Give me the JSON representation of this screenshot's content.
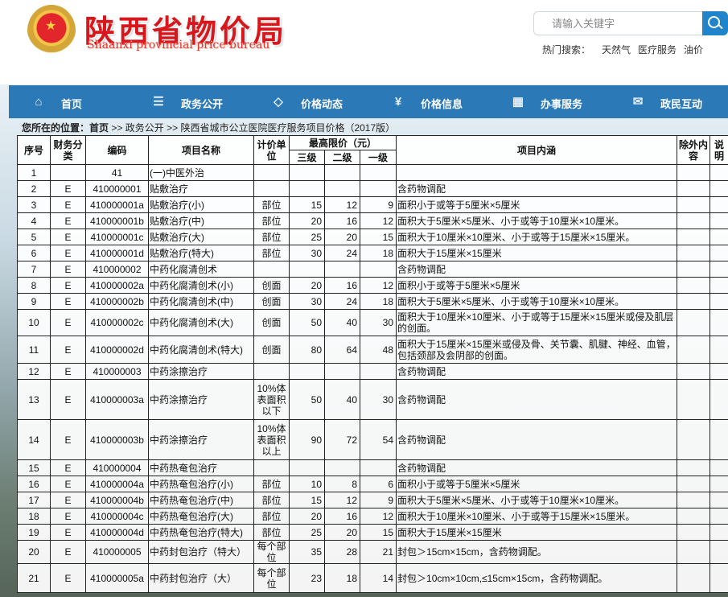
{
  "site": {
    "title_cn": "陕西省物价局",
    "title_en": "Shaanxi provincial price bureau"
  },
  "search": {
    "placeholder": "请输入关键字",
    "hot_label": "热门搜索：",
    "hot": [
      "天然气",
      "医疗服务",
      "油价"
    ]
  },
  "nav": [
    {
      "label": "首页",
      "icon": "home-icon"
    },
    {
      "label": "政务公开",
      "icon": "document-icon"
    },
    {
      "label": "价格动态",
      "icon": "tag-icon"
    },
    {
      "label": "价格信息",
      "icon": "yuan-icon"
    },
    {
      "label": "办事服务",
      "icon": "grid-icon"
    },
    {
      "label": "政民互动",
      "icon": "chat-icon"
    }
  ],
  "breadcrumb": {
    "prefix": "您所在的位置：",
    "items": [
      "首页",
      ">>",
      "政务公开",
      ">>",
      "陕西省城市公立医院医疗服务项目价格（2017版）"
    ]
  },
  "table": {
    "headers": {
      "no": "序号",
      "cat": "财务分类",
      "code": "编码",
      "name": "项目名称",
      "unit": "计价单位",
      "price_group": "最高限价（元）",
      "p3": "三级",
      "p2": "二级",
      "p1": "一级",
      "content": "项目内涵",
      "excl": "除外内容",
      "note": "说明"
    },
    "rows": [
      [
        "1",
        "",
        "41",
        "(一)中医外治",
        "",
        "",
        "",
        "",
        "",
        "",
        ""
      ],
      [
        "2",
        "E",
        "410000001",
        "贴敷治疗",
        "",
        "",
        "",
        "",
        "含药物调配",
        "",
        ""
      ],
      [
        "3",
        "E",
        "410000001a",
        "贴敷治疗(小)",
        "部位",
        "15",
        "12",
        "9",
        "面积小于或等于5厘米×5厘米",
        "",
        ""
      ],
      [
        "4",
        "E",
        "410000001b",
        "贴敷治疗(中)",
        "部位",
        "20",
        "16",
        "12",
        "面积大于5厘米×5厘米、小于或等于10厘米×10厘米。",
        "",
        ""
      ],
      [
        "5",
        "E",
        "410000001c",
        "贴敷治疗(大)",
        "部位",
        "25",
        "20",
        "15",
        "面积大于10厘米×10厘米、小于或等于15厘米×15厘米。",
        "",
        ""
      ],
      [
        "6",
        "E",
        "410000001d",
        "贴敷治疗(特大)",
        "部位",
        "30",
        "24",
        "18",
        "面积大于15厘米×15厘米",
        "",
        ""
      ],
      [
        "7",
        "E",
        "410000002",
        "中药化腐清创术",
        "",
        "",
        "",
        "",
        "含药物调配",
        "",
        ""
      ],
      [
        "8",
        "E",
        "410000002a",
        "中药化腐清创术(小)",
        "创面",
        "20",
        "16",
        "12",
        "面积小于或等于5厘米×5厘米",
        "",
        ""
      ],
      [
        "9",
        "E",
        "410000002b",
        "中药化腐清创术(中)",
        "创面",
        "30",
        "24",
        "18",
        "面积大于5厘米×5厘米、小于或等于10厘米×10厘米。",
        "",
        ""
      ],
      [
        "10",
        "E",
        "410000002c",
        "中药化腐清创术(大)",
        "创面",
        "50",
        "40",
        "30",
        "面积大于10厘米×10厘米、小于或等于15厘米×15厘米或侵及肌层的创面。",
        "",
        ""
      ],
      [
        "11",
        "E",
        "410000002d",
        "中药化腐清创术(特大)",
        "创面",
        "80",
        "64",
        "48",
        "面积大于15厘米×15厘米或侵及骨、关节囊、肌腱、神经、血管，包括颈部及会阴部的创面。",
        "",
        ""
      ],
      [
        "12",
        "E",
        "410000003",
        "中药涂擦治疗",
        "",
        "",
        "",
        "",
        "含药物调配",
        "",
        ""
      ],
      [
        "13",
        "E",
        "410000003a",
        "中药涂擦治疗",
        "10%体表面积以下",
        "50",
        "40",
        "30",
        "含药物调配",
        "",
        ""
      ],
      [
        "14",
        "E",
        "410000003b",
        "中药涂擦治疗",
        "10%体表面积以上",
        "90",
        "72",
        "54",
        "含药物调配",
        "",
        ""
      ],
      [
        "15",
        "E",
        "410000004",
        "中药热奄包治疗",
        "",
        "",
        "",
        "",
        "含药物调配",
        "",
        ""
      ],
      [
        "16",
        "E",
        "410000004a",
        "中药热奄包治疗(小)",
        "部位",
        "10",
        "8",
        "6",
        "面积小于或等于5厘米×5厘米",
        "",
        ""
      ],
      [
        "17",
        "E",
        "410000004b",
        "中药热奄包治疗(中)",
        "部位",
        "15",
        "12",
        "9",
        "面积大于5厘米×5厘米、小于或等于10厘米×10厘米。",
        "",
        ""
      ],
      [
        "18",
        "E",
        "410000004c",
        "中药热奄包治疗(大)",
        "部位",
        "20",
        "16",
        "12",
        "面积大于10厘米×10厘米、小于或等于15厘米×15厘米。",
        "",
        ""
      ],
      [
        "19",
        "E",
        "410000004d",
        "中药热奄包治疗(特大)",
        "部位",
        "25",
        "20",
        "15",
        "面积大于15厘米×15厘米",
        "",
        ""
      ],
      [
        "20",
        "E",
        "410000005",
        "中药封包治疗（特大）",
        "每个部位",
        "35",
        "28",
        "21",
        "封包＞15cm×15cm，含药物调配。",
        "",
        ""
      ],
      [
        "21",
        "E",
        "410000005a",
        "中药封包治疗（大）",
        "每个部位",
        "23",
        "18",
        "14",
        "封包＞10cm×10cm,≤15cm×15cm，含药物调配。",
        "",
        ""
      ]
    ]
  }
}
